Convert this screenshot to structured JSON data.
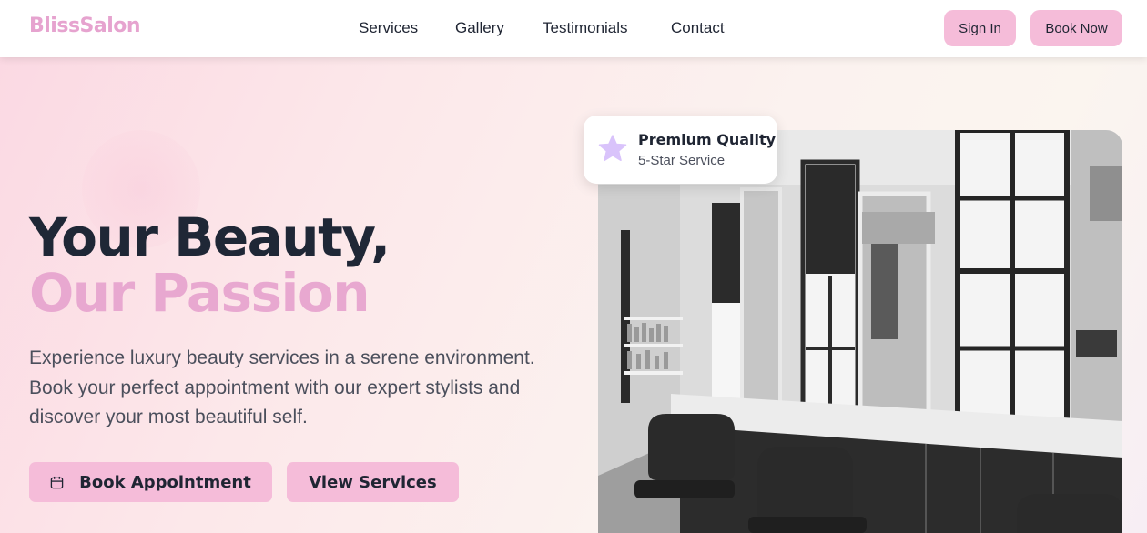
{
  "brand": {
    "logo_text": "BlissSalon",
    "accent_color": "#e6a3cf",
    "button_color": "#f5bcd9"
  },
  "nav": {
    "links": [
      "Services",
      "Gallery",
      "Testimonials",
      "Contact"
    ],
    "sign_in_label": "Sign In",
    "book_now_label": "Book Now"
  },
  "hero": {
    "headline_line1": "Your Beauty,",
    "headline_line2": "Our Passion",
    "description": "Experience luxury beauty services in a serene environment. Book your perfect appointment with our expert stylists and discover your most beautiful self.",
    "primary_cta": {
      "label": "Book Appointment",
      "icon": "calendar-icon"
    },
    "secondary_cta": {
      "label": "View Services"
    }
  },
  "badge": {
    "icon": "star-icon",
    "title": "Premium Quality",
    "subtitle": "5-Star Service"
  },
  "image": {
    "alt": "salon-interior-photo"
  }
}
